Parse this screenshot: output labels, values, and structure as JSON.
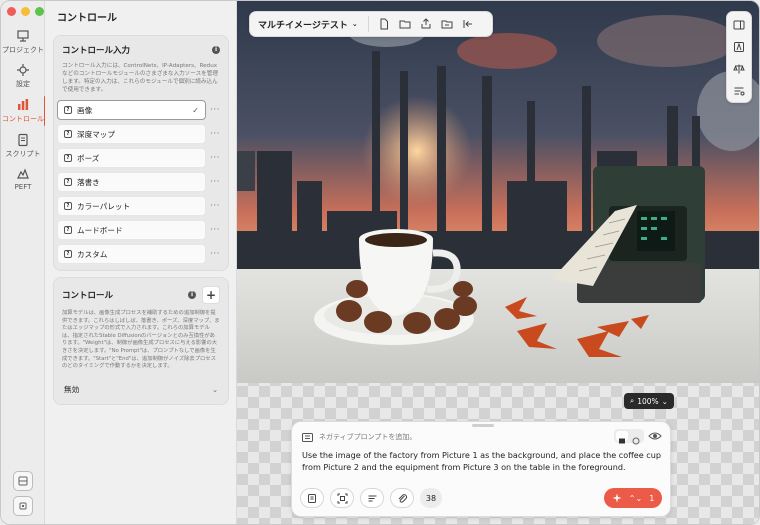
{
  "rail": {
    "items": [
      {
        "label": "プロジェクト",
        "icon": "project-icon"
      },
      {
        "label": "設定",
        "icon": "settings-icon"
      },
      {
        "label": "コントロール",
        "icon": "control-icon",
        "active": true
      },
      {
        "label": "スクリプト",
        "icon": "script-icon"
      },
      {
        "label": "PEFT",
        "icon": "peft-icon"
      }
    ]
  },
  "panel": {
    "title": "コントロール",
    "inputs_card": {
      "title": "コントロール入力",
      "description": "コントロール入力には、ControlNets、IP-Adapters、Reduxなどのコントロールモジュールのさまざまな入力ソースを管理します。特定の入力は、これらのモジュールで個別に読み込んで使用できます。",
      "items": [
        "画像",
        "深度マップ",
        "ポーズ",
        "落書き",
        "カラーパレット",
        "ムードボード",
        "カスタム"
      ]
    },
    "control_card": {
      "title": "コントロール",
      "description": "加算モデルは、画像生成プロセスを補助するための追加制御を提供できます。これらはしばしば、落書き、ポーズ、深度マップ、またはエッジマップの形式で入力されます。これらの加算モデルは、指定されたStable Diffusionのバージョンとのみ互換性があります。\"Weight\"は、制御が画像生成プロセスに与える影響の大きさを決定します。\"No Prompt\"は、プロンプトなしで画像を生成できます。\"Start\"と\"End\"は、追加制御がノイズ除去プロセスのどのタイミングで作動するかを決定します。",
      "select_value": "無効"
    }
  },
  "toolbar": {
    "project_name": "マルチイメージテスト"
  },
  "zoom": {
    "level": "100%"
  },
  "prompt": {
    "negative_placeholder": "ネガティブプロンプトを追加。",
    "text": "Use the image of the factory from Picture 1 as the background, and place the coffee cup from Picture 2 and the equipment from Picture 3 on the table in the foreground.",
    "steps_count": "38",
    "generate_count": "1"
  },
  "colors": {
    "accent": "#e2533c",
    "generate": "#ec5a48"
  }
}
